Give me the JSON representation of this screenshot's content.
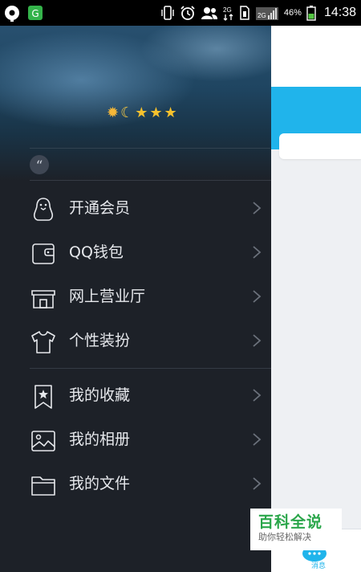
{
  "status_bar": {
    "network_type": "2G",
    "battery_percent": "46%",
    "time": "14:38",
    "icons": [
      "record-icon",
      "app-notification-icon",
      "vibrate-icon",
      "alarm-icon",
      "contacts-icon",
      "data-transfer-icon",
      "sim-icon",
      "signal-icon",
      "battery-icon"
    ]
  },
  "drawer": {
    "level_icons": [
      "sun-icon",
      "moon-icon",
      "star-icon",
      "star-icon",
      "star-icon"
    ],
    "signature_icon": "quote-icon",
    "menu_groups": [
      [
        {
          "label": "开通会员",
          "icon": "penguin-icon"
        },
        {
          "label": "QQ钱包",
          "icon": "wallet-icon"
        },
        {
          "label": "网上营业厅",
          "icon": "store-icon"
        },
        {
          "label": "个性装扮",
          "icon": "tshirt-icon"
        }
      ],
      [
        {
          "label": "我的收藏",
          "icon": "bookmark-star-icon"
        },
        {
          "label": "我的相册",
          "icon": "photo-album-icon"
        },
        {
          "label": "我的文件",
          "icon": "folder-icon"
        }
      ]
    ]
  },
  "right_panel": {
    "bottom_tab_label": "消息",
    "accent_color": "#20b4eb"
  },
  "watermark": {
    "title": "百科全说",
    "subtitle": "助你轻松解决"
  }
}
